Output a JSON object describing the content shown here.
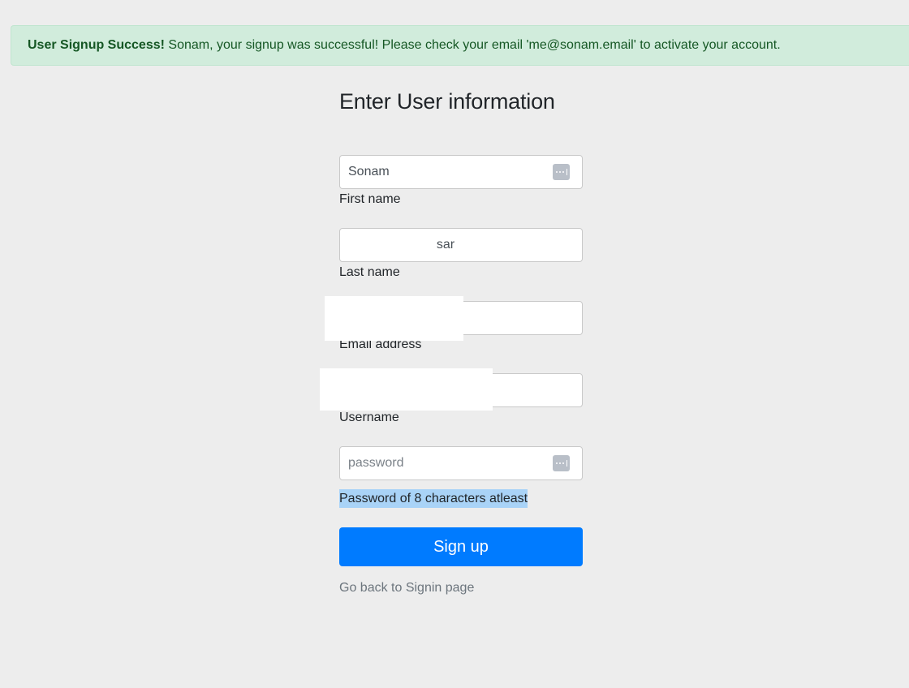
{
  "alert": {
    "type": "success",
    "title": "User Signup Success!",
    "message": "Sonam, your signup was successful! Please check your email 'me@sonam.email' to activate your account.",
    "colors": {
      "background": "#d1ecdc",
      "text": "#155724"
    }
  },
  "form": {
    "title": "Enter User information",
    "fields": [
      {
        "label": "First name",
        "value": "Sonam",
        "placeholder": "",
        "autofill_icon": "password-manager-key-icon"
      },
      {
        "label": "Last name",
        "value": "sar",
        "placeholder": ""
      },
      {
        "label": "Email address",
        "value": "",
        "placeholder": "",
        "redacted": true
      },
      {
        "label": "Username",
        "value": "",
        "placeholder": "",
        "redacted": true
      },
      {
        "label": "",
        "value": "",
        "placeholder": "password",
        "autofill_icon": "password-manager-key-icon"
      }
    ],
    "password_hint": "Password of 8 characters atleast",
    "submit_label": "Sign up",
    "back_link": "Go back to Signin page",
    "accent_color": "#007bff"
  }
}
